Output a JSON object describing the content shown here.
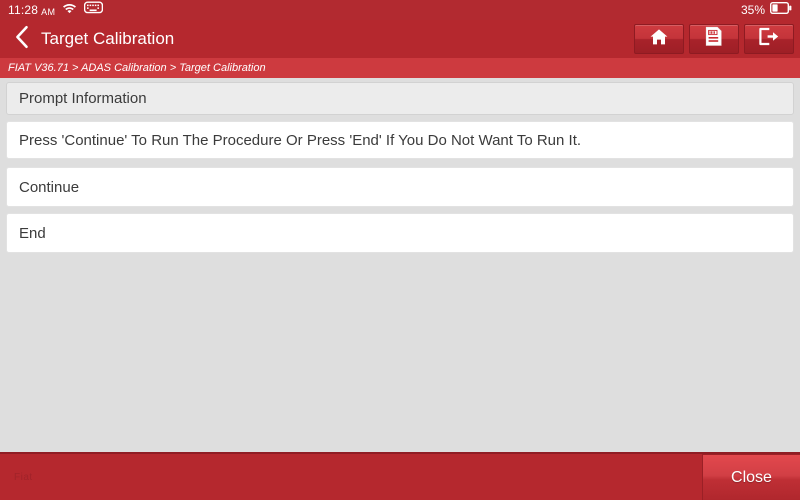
{
  "statusbar": {
    "time": "11:28",
    "ampm": "AM",
    "wifi_icon": "wifi-icon",
    "keyboard_icon": "keyboard-icon",
    "battery_percent": "35%",
    "battery_icon": "battery-icon"
  },
  "titlebar": {
    "back_icon": "chevron-left-icon",
    "title": "Target Calibration",
    "actions": [
      {
        "name": "home-button",
        "icon": "home-icon"
      },
      {
        "name": "report-button",
        "icon": "report-icon"
      },
      {
        "name": "exit-button",
        "icon": "exit-icon"
      }
    ]
  },
  "breadcrumb": {
    "text": "FIAT V36.71 > ADAS Calibration > Target Calibration"
  },
  "main": {
    "section_header": "Prompt Information",
    "prompt_text": "Press 'Continue' To Run The Procedure Or Press 'End' If You Do Not Want To Run It.",
    "options": [
      {
        "label": "Continue"
      },
      {
        "label": "End"
      }
    ]
  },
  "bottombar": {
    "brand": "Fiat",
    "close_label": "Close"
  },
  "colors": {
    "brand_red": "#b5282e",
    "breadcrumb_red": "#cd3a3f",
    "page_bg": "#dedede",
    "row_white": "#ffffff",
    "row_header_gray": "#ececec",
    "text_dark": "#3b3b3b"
  }
}
